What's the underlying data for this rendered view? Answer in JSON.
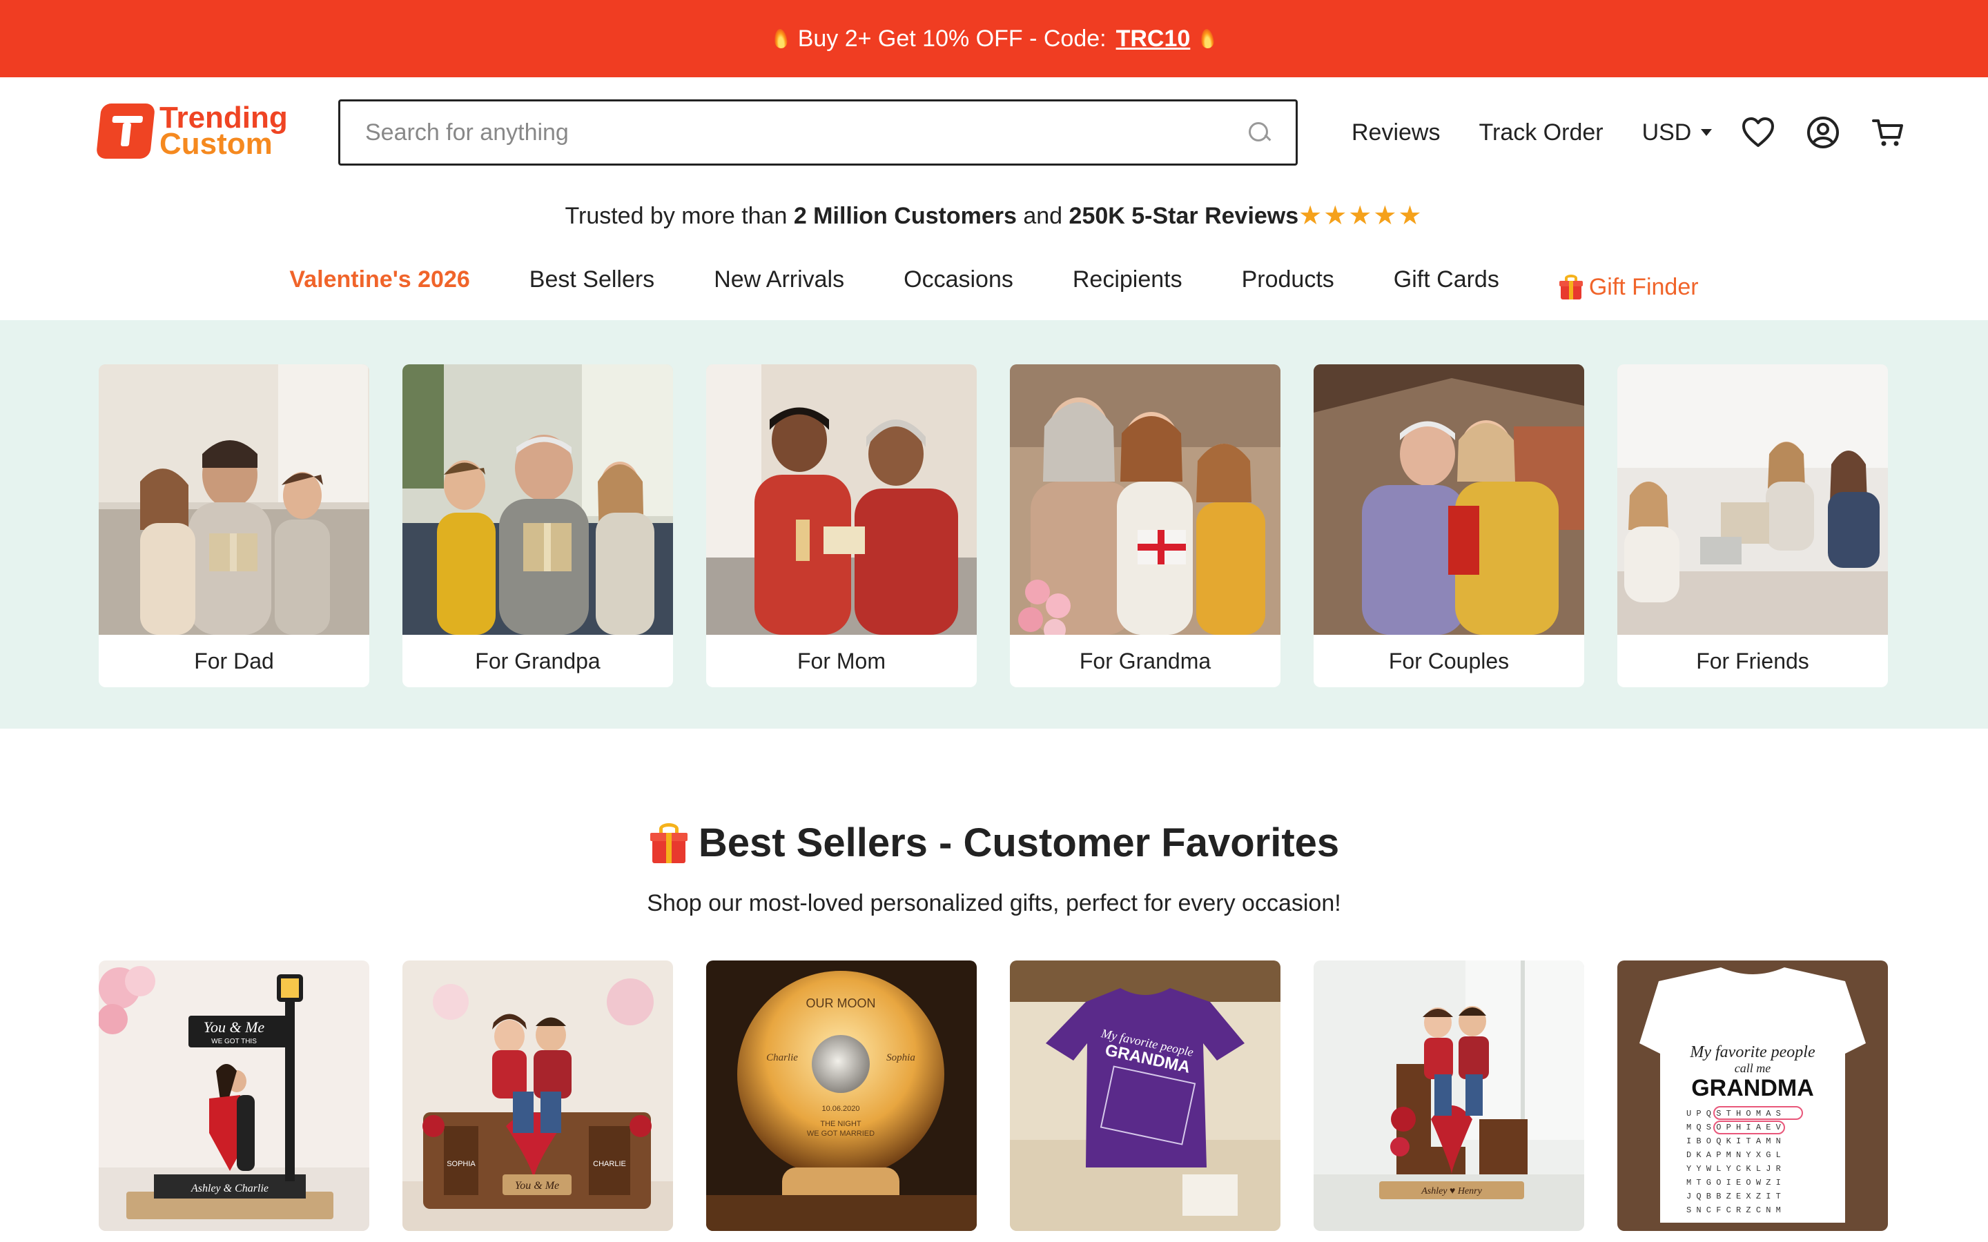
{
  "promo": {
    "text": "Buy 2+ Get 10% OFF - Code:",
    "code": "TRC10"
  },
  "logo": {
    "line1": "Trending",
    "line2": "Custom"
  },
  "search": {
    "placeholder": "Search for anything"
  },
  "header": {
    "reviews": "Reviews",
    "track_order": "Track Order",
    "currency": "USD"
  },
  "trust": {
    "prefix": "Trusted by more than",
    "customers": "2 Million Customers",
    "middle": "and",
    "reviews": "250K 5-Star Reviews",
    "stars": "★★★★★"
  },
  "nav": {
    "items": [
      "Valentine's 2026",
      "Best Sellers",
      "New Arrivals",
      "Occasions",
      "Recipients",
      "Products",
      "Gift Cards",
      "Gift Finder"
    ]
  },
  "categories": [
    "For Dad",
    "For Grandpa",
    "For Mom",
    "For Grandma",
    "For Couples",
    "For Friends"
  ],
  "section": {
    "title": "Best Sellers - Customer Favorites",
    "subtitle": "Shop our most-loved personalized gifts, perfect for every occasion!"
  },
  "products": {
    "p1_sign": "You & Me",
    "p1_sign2": "WE GOT THIS",
    "p1_base": "Ashley & Charlie",
    "p2_left": "SOPHIA",
    "p2_right": "CHARLIE",
    "p2_plaque": "You & Me",
    "p3_top": "OUR MOON",
    "p3_left": "Charlie",
    "p3_right": "Sophia",
    "p3_date": "10.06.2020",
    "p3_l1": "THE NIGHT",
    "p3_l2": "WE GOT MARRIED",
    "p4_l1": "My favorite people",
    "p4_l2": "GRANDMA",
    "p5_plaque": "Ashley ♥ Henry",
    "p6_l1": "My favorite people",
    "p6_l2": "call me",
    "p6_l3": "GRANDMA"
  },
  "colors": {
    "promo_bg": "#f03d22",
    "accent": "#f0642a",
    "band_bg": "#e6f3ef"
  }
}
